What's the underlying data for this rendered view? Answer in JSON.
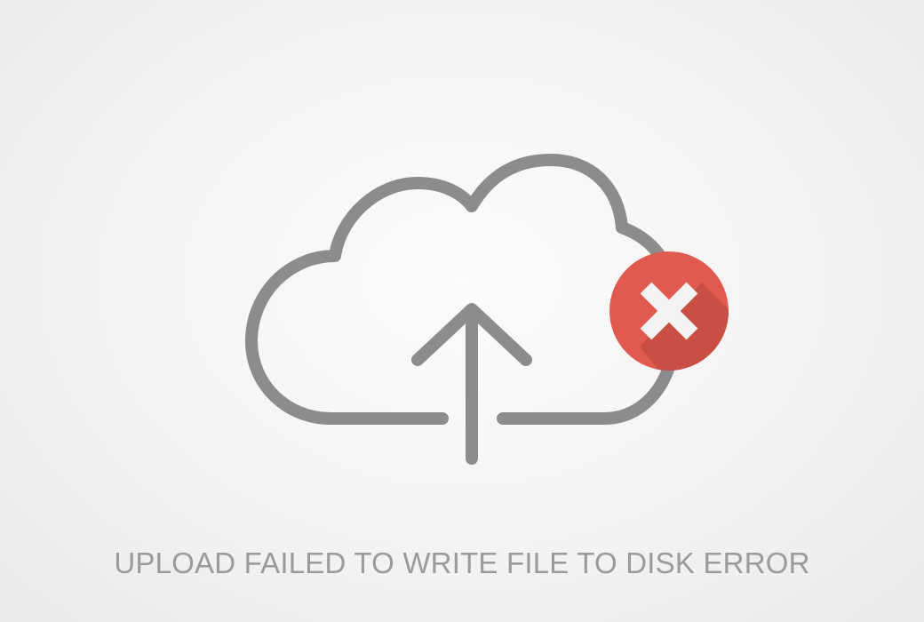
{
  "message": {
    "text": "UPLOAD FAILED TO WRITE FILE TO DISK ERROR"
  },
  "icons": {
    "cloud": "cloud-icon",
    "arrow": "upload-arrow-icon",
    "error": "error-x-icon"
  },
  "colors": {
    "background": "#f2f2f2",
    "icon_stroke": "#8c8c8c",
    "text": "#9a9a9a",
    "error_badge": "#e05a4f",
    "error_badge_shadow": "#b8473f",
    "error_mark": "#f3f3f3"
  }
}
